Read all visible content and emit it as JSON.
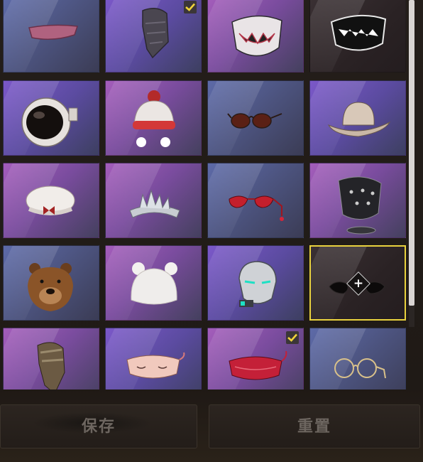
{
  "items": [
    {
      "id": "visor",
      "name": "visor-icon",
      "checked": false,
      "selected": false,
      "color": "c3"
    },
    {
      "id": "scarf",
      "name": "scarf-mask-icon",
      "checked": true,
      "selected": false,
      "color": "c2"
    },
    {
      "id": "teeth_mask",
      "name": "teeth-mask-icon",
      "checked": false,
      "selected": false,
      "color": "c1"
    },
    {
      "id": "black_mask",
      "name": "black-face-mask-icon",
      "checked": false,
      "selected": false,
      "color": "dark"
    },
    {
      "id": "astronaut",
      "name": "astronaut-helmet-icon",
      "checked": false,
      "selected": false,
      "color": "c2"
    },
    {
      "id": "beanie",
      "name": "pompom-beanie-icon",
      "checked": false,
      "selected": false,
      "color": "c1"
    },
    {
      "id": "sunglasses",
      "name": "sunglasses-icon",
      "checked": false,
      "selected": false,
      "color": "c3"
    },
    {
      "id": "cowboy",
      "name": "cowboy-hat-icon",
      "checked": false,
      "selected": false,
      "color": "c2"
    },
    {
      "id": "beret",
      "name": "beret-with-bow-icon",
      "checked": false,
      "selected": false,
      "color": "c1"
    },
    {
      "id": "tiara",
      "name": "tiara-icon",
      "checked": false,
      "selected": false,
      "color": "c1"
    },
    {
      "id": "red_glasses",
      "name": "red-cat-eye-glasses-icon",
      "checked": false,
      "selected": false,
      "color": "c3"
    },
    {
      "id": "spike_mask",
      "name": "spiked-mask-icon",
      "checked": false,
      "selected": false,
      "color": "c1"
    },
    {
      "id": "bear",
      "name": "bear-head-icon",
      "checked": false,
      "selected": false,
      "color": "c3"
    },
    {
      "id": "bear_beanie",
      "name": "white-bear-beanie-icon",
      "checked": false,
      "selected": false,
      "color": "c1"
    },
    {
      "id": "robot",
      "name": "robot-helmet-icon",
      "checked": false,
      "selected": false,
      "color": "c2"
    },
    {
      "id": "empty",
      "name": "empty-slot-icon",
      "checked": false,
      "selected": true,
      "color": "dark"
    },
    {
      "id": "hood",
      "name": "camo-hood-icon",
      "checked": false,
      "selected": false,
      "color": "c1"
    },
    {
      "id": "sleep_mask_pink",
      "name": "pink-sleep-mask-icon",
      "checked": false,
      "selected": false,
      "color": "c2"
    },
    {
      "id": "sleep_mask_red",
      "name": "red-sleep-mask-icon",
      "checked": true,
      "selected": false,
      "color": "c1"
    },
    {
      "id": "round_glasses",
      "name": "round-glasses-icon",
      "checked": false,
      "selected": false,
      "color": "c3"
    }
  ],
  "footer": {
    "save_label": "保存",
    "reset_label": "重置"
  },
  "colors": {
    "selected_border": "#e9d23e",
    "check_mark": "#f0d33a"
  }
}
